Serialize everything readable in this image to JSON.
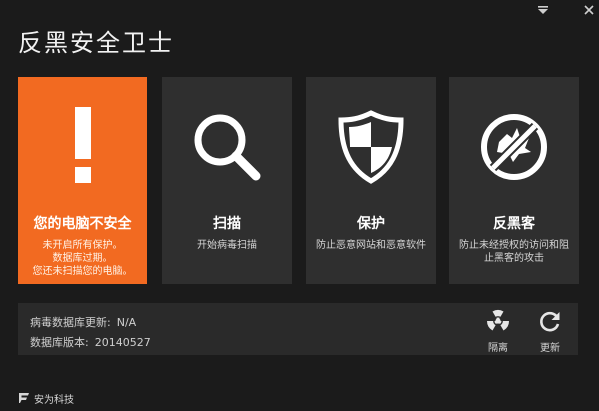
{
  "window": {
    "title": "反黑安全卫士"
  },
  "tiles": [
    {
      "title": "您的电脑不安全",
      "desc": "未开启所有保护。\n数据库过期。\n您还未扫描您的电脑。"
    },
    {
      "title": "扫描",
      "desc": "开始病毒扫描"
    },
    {
      "title": "保护",
      "desc": "防止恶意网站和恶意软件"
    },
    {
      "title": "反黑客",
      "desc": "防止未经授权的访问和阻止黑客的攻击"
    }
  ],
  "info": {
    "db_update_label": "病毒数据库更新:",
    "db_update_value": "N/A",
    "db_version_label": "数据库版本:",
    "db_version_value": "20140527"
  },
  "actions": {
    "quarantine_label": "隔离",
    "update_label": "更新"
  },
  "footer": {
    "brand": "安为科技"
  },
  "colors": {
    "alert_tile": "#f26a21",
    "tile": "#2f2f2f",
    "background": "#1b1b1b"
  },
  "icons": {
    "status": "exclamation-icon",
    "scan": "magnifier-icon",
    "protect": "shield-icon",
    "antihacker": "no-hacker-icon",
    "quarantine": "radiation-icon",
    "update": "refresh-icon"
  }
}
